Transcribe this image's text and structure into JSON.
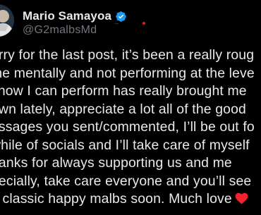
{
  "author": {
    "display_name": "Mario Samayoa",
    "handle": "@G2malbsMd",
    "verified_icon": "verified-badge-icon",
    "avatar_icon": "profile-avatar"
  },
  "tweet": {
    "lines": [
      "orry for the last post, it’s been a really roug",
      "me mentally and not performing at the leve",
      "know I can perform has really brought me",
      "own lately, appreciate a lot all of the good",
      "essages you sent/commented, I’ll be out fo",
      "while of socials and I’ll take care of myself",
      "hanks for always supporting us and me",
      "pecially, take care everyone and you’ll see",
      "e classic happy malbs soon. Much love"
    ],
    "emoji": "red-heart-icon"
  },
  "colors": {
    "background": "#000000",
    "text": "#e7e9ea",
    "muted": "#71767b",
    "verified": "#1d9bf0",
    "heart": "#f4212e"
  }
}
